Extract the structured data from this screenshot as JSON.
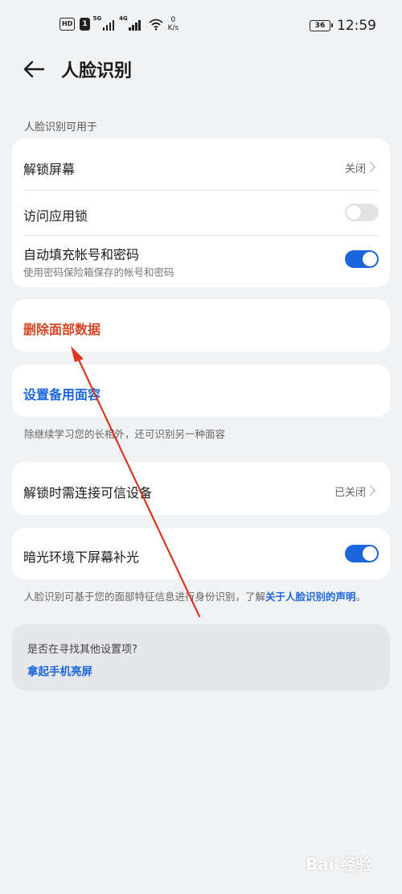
{
  "status_bar": {
    "hd1": "HD",
    "hd2": "1",
    "sig1_tag": "5G",
    "sig2_tag": "4G",
    "speed_value": "0",
    "speed_unit": "K/s",
    "battery": "36",
    "time": "12:59"
  },
  "header": {
    "title": "人脸识别"
  },
  "usage_section": {
    "label": "人脸识别可用于",
    "unlock_screen": {
      "label": "解锁屏幕",
      "value": "关闭"
    },
    "app_lock": {
      "label": "访问应用锁",
      "enabled": false
    },
    "autofill": {
      "label": "自动填充帐号和密码",
      "desc": "使用密码保险箱保存的帐号和密码",
      "enabled": true
    }
  },
  "delete_face": {
    "label": "删除面部数据"
  },
  "alt_face": {
    "label": "设置备用面容",
    "note": "除继续学习您的长相外，还可识别另一种面容"
  },
  "trusted_device": {
    "label": "解锁时需连接可信设备",
    "value": "已关闭"
  },
  "low_light": {
    "label": "暗光环境下屏幕补光",
    "enabled": true
  },
  "disclaimer": {
    "text": "人脸识别可基于您的面部特征信息进行身份识别，了解",
    "link": "关于人脸识别的声明",
    "end": "。"
  },
  "suggestion": {
    "question": "是否在寻找其他设置项?",
    "link": "拿起手机亮屏"
  },
  "watermark": "Bai 经验",
  "colors": {
    "accent": "#1b66dd",
    "danger": "#d64423",
    "annotation_arrow": "#d9371f"
  }
}
